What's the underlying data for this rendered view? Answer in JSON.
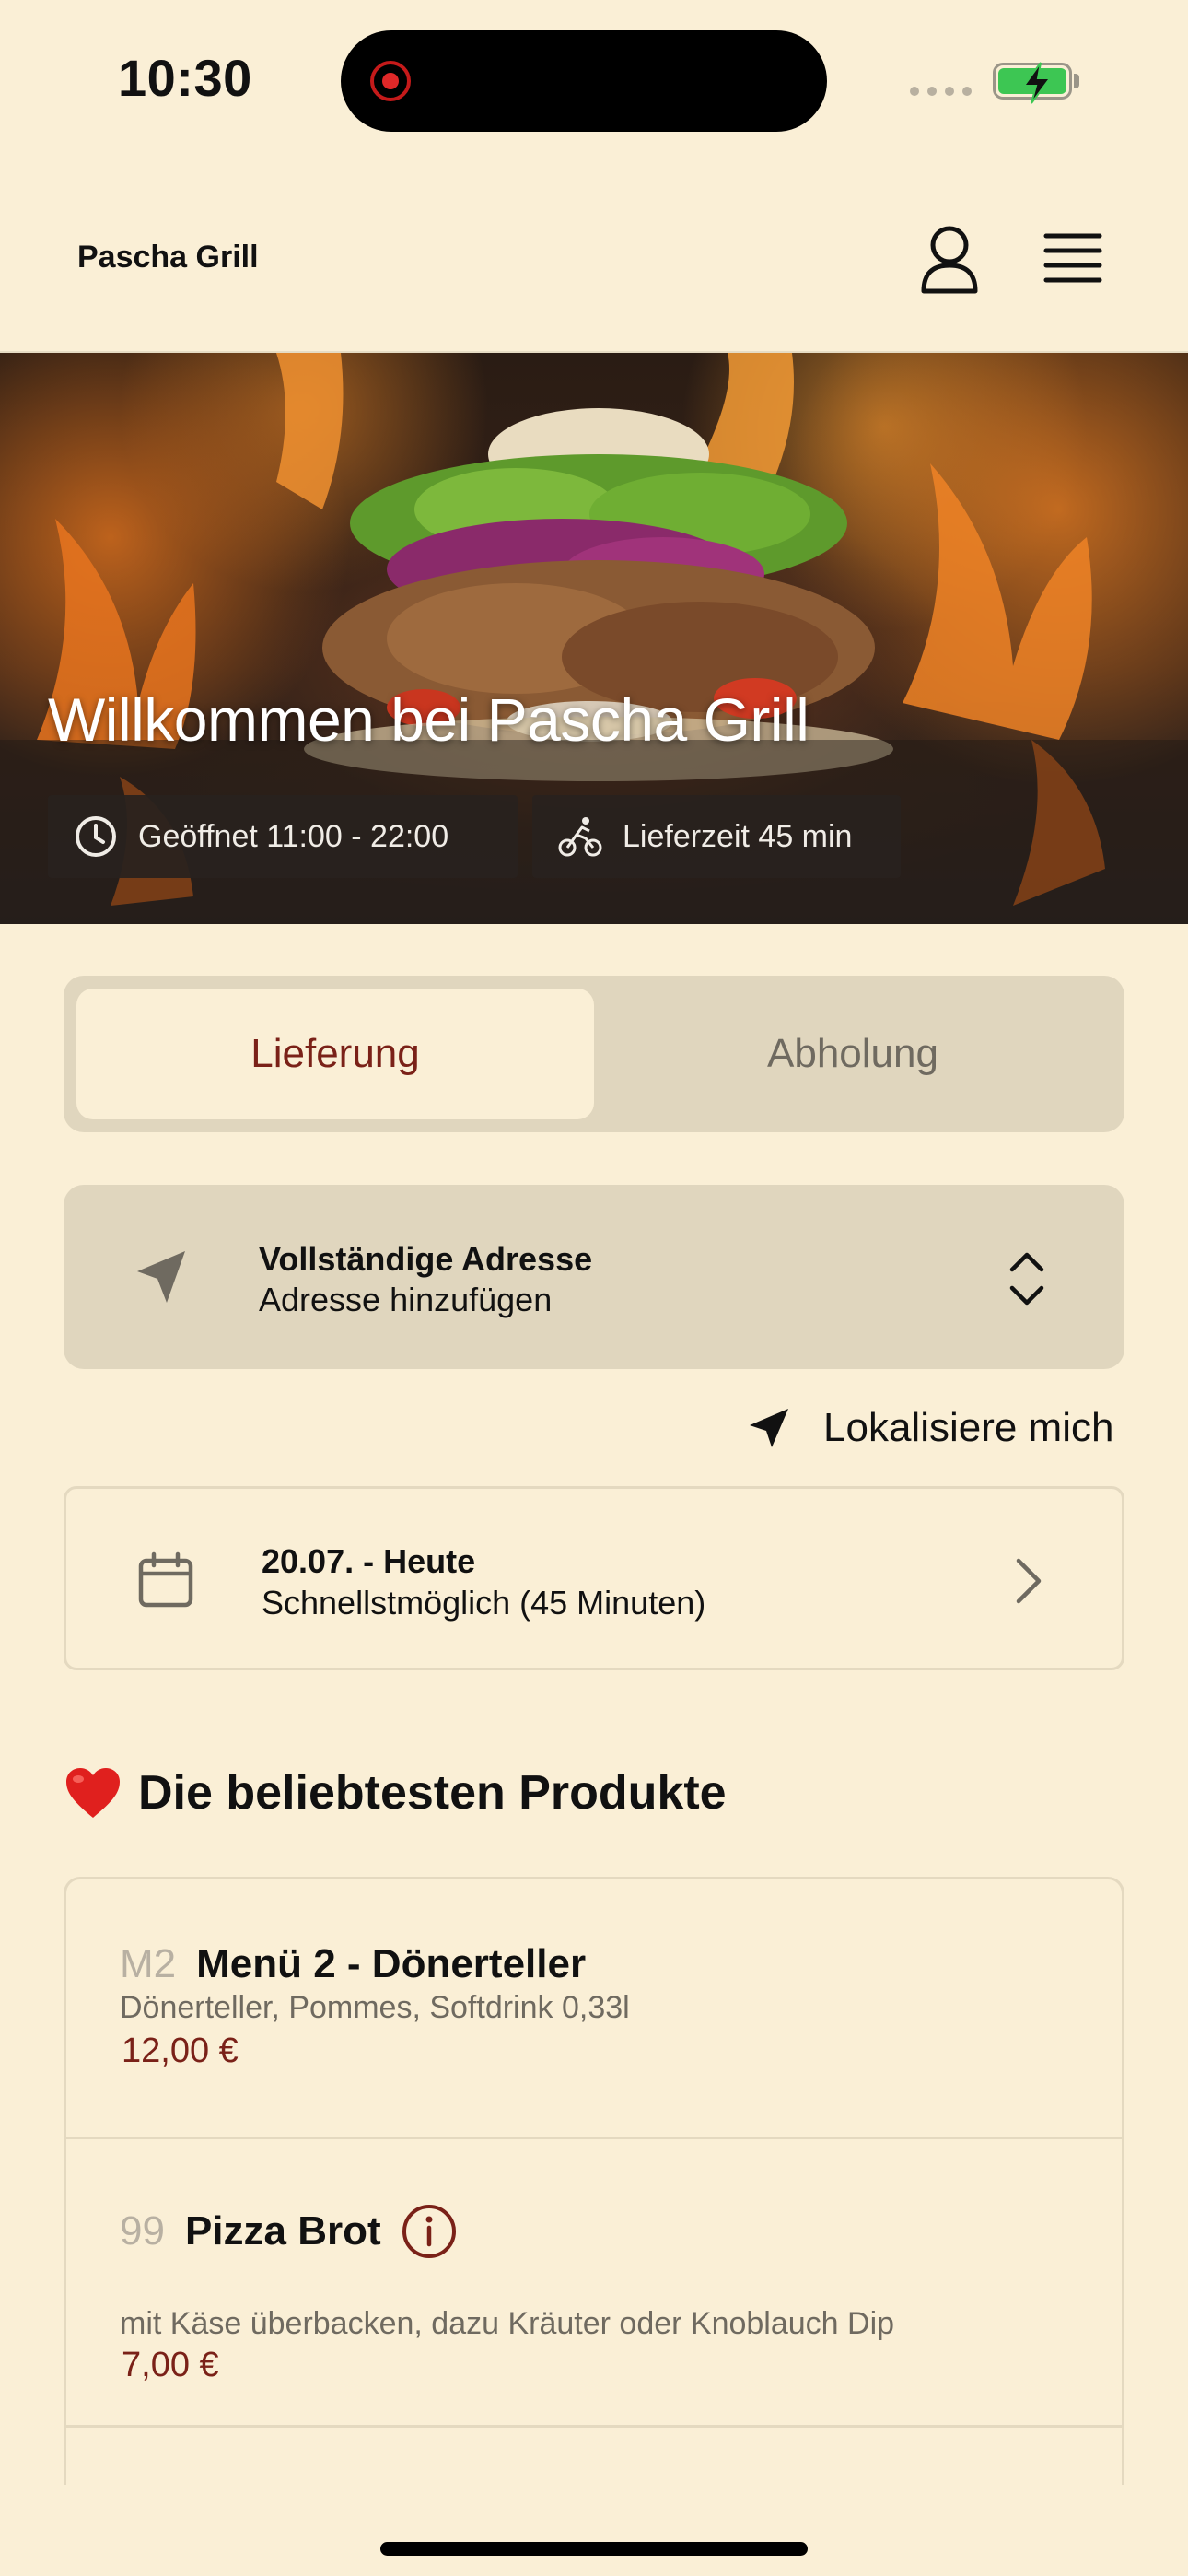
{
  "status_bar": {
    "time": "10:30"
  },
  "header": {
    "brand": "Pascha Grill",
    "profile_icon": "person-icon",
    "menu_icon": "hamburger-menu-icon"
  },
  "hero": {
    "title": "Willkommen bei Pascha Grill",
    "hours_label": "Geöffnet 11:00 - 22:00",
    "delivery_label": "Lieferzeit 45 min",
    "hours_icon": "clock-icon",
    "delivery_icon": "cyclist-icon"
  },
  "order_mode": {
    "tabs": [
      {
        "label": "Lieferung",
        "active": true
      },
      {
        "label": "Abholung",
        "active": false
      }
    ]
  },
  "address": {
    "title": "Vollständige Adresse",
    "subtitle": "Adresse hinzufügen",
    "locate_label": "Lokalisiere mich"
  },
  "schedule": {
    "date": "20.07. - Heute",
    "time": "Schnellstmöglich (45 Minuten)"
  },
  "popular": {
    "title": "Die beliebtesten Produkte",
    "products": [
      {
        "number": "M2",
        "name": "Menü 2 - Dönerteller",
        "description": "Dönerteller, Pommes, Softdrink 0,33l",
        "price": "12,00 €"
      },
      {
        "number": "99",
        "name": "Pizza Brot",
        "description": "mit Käse überbacken, dazu Kräuter oder Knoblauch Dip",
        "price": "7,00 €",
        "has_info": true
      }
    ]
  },
  "colors": {
    "background": "#FAEFD6",
    "surface": "#E0D6BE",
    "accent": "#7A2118",
    "battery": "#3DC653"
  }
}
